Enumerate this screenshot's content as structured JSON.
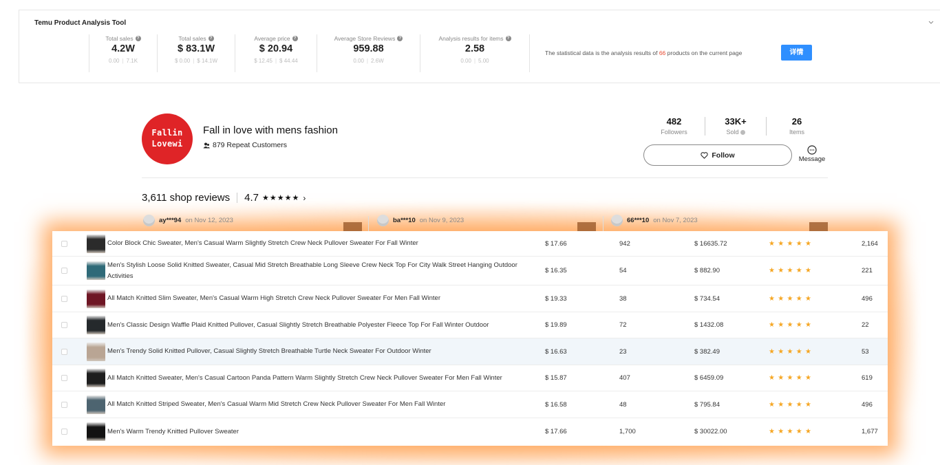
{
  "panel": {
    "title": "Temu Product Analysis Tool",
    "stats": [
      {
        "label": "Total sales",
        "value": "4.2W",
        "min": "0.00",
        "max": "7.1K"
      },
      {
        "label": "Total sales",
        "value": "$ 83.1W",
        "min": "$ 0.00",
        "max": "$ 14.1W"
      },
      {
        "label": "Average price",
        "value": "$ 20.94",
        "min": "$ 12.45",
        "max": "$ 44.44"
      },
      {
        "label": "Average Store Reviews",
        "value": "959.88",
        "min": "0.00",
        "max": "2.6W"
      },
      {
        "label": "Analysis results for items",
        "value": "2.58",
        "min": "0.00",
        "max": "5.00"
      }
    ],
    "summary_prefix": "The statistical data is the analysis results of ",
    "summary_count": "66",
    "summary_suffix": " products on the current page",
    "detail_button": "详情",
    "accent_color": "#2f8fff",
    "highlight_color": "#e8472e"
  },
  "store": {
    "logo_line1": "Fallin",
    "logo_line2": "Lovewi",
    "name": "Fall in love with mens fashion",
    "repeat_customers": "879 Repeat Customers",
    "stats": [
      {
        "value": "482",
        "label": "Followers"
      },
      {
        "value": "33K+",
        "label": "Sold"
      },
      {
        "value": "26",
        "label": "Items"
      }
    ],
    "follow_label": "Follow",
    "message_label": "Message"
  },
  "reviews": {
    "count_label": "3,611 shop reviews",
    "rating": "4.7",
    "rating_stars": "★★★★★",
    "items": [
      {
        "user": "ay***94",
        "date": "on Nov 12, 2023"
      },
      {
        "user": "ba***10",
        "date": "on Nov 9, 2023"
      },
      {
        "user": "66***10",
        "date": "on Nov 7, 2023"
      }
    ]
  },
  "products": [
    {
      "name": "Color Block Chic Sweater, Men's Casual Warm Slightly Stretch Crew Neck Pullover Sweater For Fall Winter",
      "price": "$ 17.66",
      "sales": "942",
      "gmv": "$ 16635.72",
      "rating": 4.5,
      "reviews": "2,164",
      "thumb": "#2b2b2b"
    },
    {
      "name": "Men's Stylish Loose Solid Knitted Sweater, Casual Mid Stretch Breathable Long Sleeve Crew Neck Top For City Walk Street Hanging Outdoor Activities",
      "price": "$ 16.35",
      "sales": "54",
      "gmv": "$ 882.90",
      "rating": 4.5,
      "reviews": "221",
      "thumb": "#2f6a78"
    },
    {
      "name": "All Match Knitted Slim Sweater, Men's Casual Warm High Stretch Crew Neck Pullover Sweater For Men Fall Winter",
      "price": "$ 19.33",
      "sales": "38",
      "gmv": "$ 734.54",
      "rating": 4.5,
      "reviews": "496",
      "thumb": "#6e1624"
    },
    {
      "name": "Men's Classic Design Waffle Plaid Knitted Pullover, Casual Slightly Stretch Breathable Polyester Fleece Top For Fall Winter Outdoor",
      "price": "$ 19.89",
      "sales": "72",
      "gmv": "$ 1432.08",
      "rating": 4.5,
      "reviews": "22",
      "thumb": "#25292c"
    },
    {
      "name": "Men's Trendy Solid Knitted Pullover, Casual Slightly Stretch Breathable Turtle Neck Sweater For Outdoor Winter",
      "price": "$ 16.63",
      "sales": "23",
      "gmv": "$ 382.49",
      "rating": 4.5,
      "reviews": "53",
      "thumb": "#b9a594"
    },
    {
      "name": "All Match Knitted Sweater, Men's Casual Cartoon Panda Pattern Warm Slightly Stretch Crew Neck Pullover Sweater For Men Fall Winter",
      "price": "$ 15.87",
      "sales": "407",
      "gmv": "$ 6459.09",
      "rating": 4.5,
      "reviews": "619",
      "thumb": "#1e1e1e"
    },
    {
      "name": "All Match Knitted Striped Sweater, Men's Casual Warm Mid Stretch Crew Neck Pullover Sweater For Men Fall Winter",
      "price": "$ 16.58",
      "sales": "48",
      "gmv": "$ 795.84",
      "rating": 4.5,
      "reviews": "496",
      "thumb": "#4d6470"
    },
    {
      "name": "Men's Warm Trendy Knitted Pullover Sweater",
      "price": "$ 17.66",
      "sales": "1,700",
      "gmv": "$ 30022.00",
      "rating": 4.5,
      "reviews": "1,677",
      "thumb": "#121212"
    }
  ],
  "row_stars": "★★★★★"
}
